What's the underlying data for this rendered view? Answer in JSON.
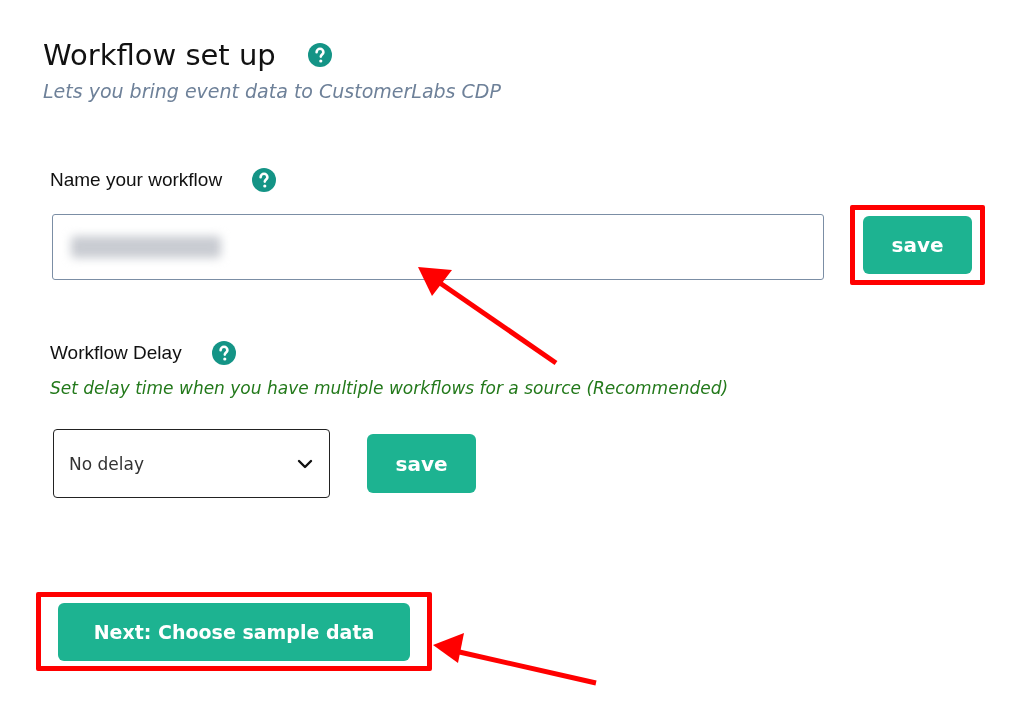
{
  "header": {
    "title": "Workflow set up",
    "subtitle": "Lets you bring event data to CustomerLabs CDP"
  },
  "name_section": {
    "label": "Name your workflow",
    "input": {
      "redacted": true
    },
    "button": "save"
  },
  "delay_section": {
    "label": "Workflow Delay",
    "hint": "Set delay time when you have multiple workflows for a source (Recommended)",
    "select": {
      "value": "No delay"
    },
    "button": "save"
  },
  "next_button": "Next: Choose sample data"
}
